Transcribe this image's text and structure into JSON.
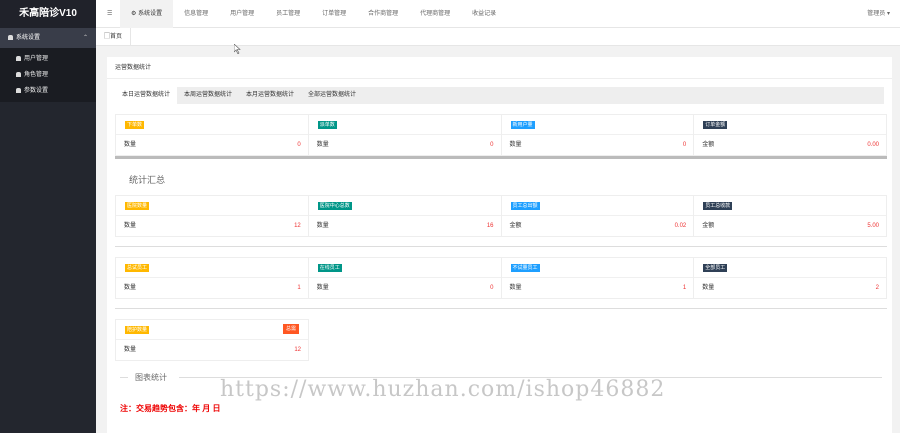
{
  "app": {
    "logo": "禾高陪诊V10"
  },
  "sidebar": {
    "group": "系统设置",
    "items": [
      {
        "label": "用户管理"
      },
      {
        "label": "角色管理"
      },
      {
        "label": "参数设置"
      }
    ]
  },
  "topnav": {
    "items": [
      {
        "label": "系统设置"
      },
      {
        "label": "信息管理"
      },
      {
        "label": "用户管理"
      },
      {
        "label": "员工管理"
      },
      {
        "label": "订单管理"
      },
      {
        "label": "合作商管理"
      },
      {
        "label": "代理商管理"
      },
      {
        "label": "收益记录"
      }
    ],
    "user": "管理员"
  },
  "tabs": {
    "home": "首页"
  },
  "panel": {
    "title": "运营数据统计",
    "tabs": [
      "本日运营数据统计",
      "本周运营数据统计",
      "本月运营数据统计",
      "全部运营数据统计"
    ]
  },
  "row1": [
    {
      "badge": "下单数",
      "label": "数量",
      "value": "0"
    },
    {
      "badge": "派单数",
      "label": "数量",
      "value": "0"
    },
    {
      "badge": "新用户量",
      "label": "数量",
      "value": "0"
    },
    {
      "badge": "订单金额",
      "label": "金额",
      "value": "0.00"
    }
  ],
  "summary_title": "统计汇总",
  "row2": [
    {
      "badge": "医院数量",
      "label": "数量",
      "value": "12"
    },
    {
      "badge": "医院中心总数",
      "label": "数量",
      "value": "16"
    },
    {
      "badge": "员工总出额",
      "label": "金额",
      "value": "0.02"
    },
    {
      "badge": "员工总收款",
      "label": "金额",
      "value": "5.00"
    }
  ],
  "row3": [
    {
      "badge": "总试员工",
      "label": "数量",
      "value": "1"
    },
    {
      "badge": "在线员工",
      "label": "数量",
      "value": "0"
    },
    {
      "badge": "不试量员工",
      "label": "数量",
      "value": "1"
    },
    {
      "badge": "全部员工",
      "label": "数量",
      "value": "2"
    }
  ],
  "row4": [
    {
      "badge": "陪护数量",
      "tag": "总需",
      "label": "数量",
      "value": "12"
    }
  ],
  "chart_section": "图表统计",
  "note": "注：交易趋势包含：年 月 日",
  "watermark": "https://www.huzhan.com/ishop46882",
  "colors": {
    "sidebar": "#23262e",
    "yellow": "#ffb800",
    "green": "#009688",
    "blue": "#1e9fff",
    "dark": "#2f4056",
    "orange": "#ff5722",
    "red": "#e33"
  }
}
